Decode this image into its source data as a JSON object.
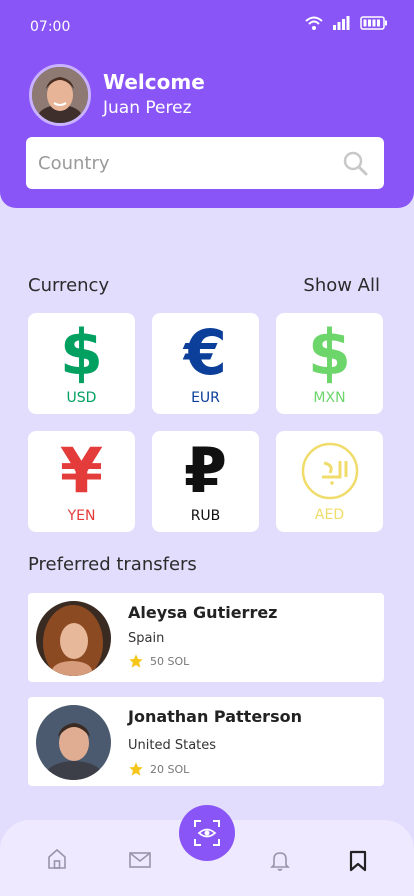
{
  "status_bar": {
    "time": "07:00"
  },
  "header": {
    "welcome": "Welcome",
    "username": "Juan Perez"
  },
  "search": {
    "placeholder": "Country",
    "value": ""
  },
  "currency": {
    "title": "Currency",
    "show_all": "Show All",
    "items": [
      {
        "glyph": "$",
        "code": "USD",
        "color": "#00a060"
      },
      {
        "glyph": "€",
        "code": "EUR",
        "color": "#0b3f9a"
      },
      {
        "glyph": "$",
        "code": "MXN",
        "color": "#6cd66b"
      },
      {
        "glyph": "¥",
        "code": "YEN",
        "color": "#e43b3b"
      },
      {
        "glyph": "₽",
        "code": "RUB",
        "color": "#111111"
      },
      {
        "glyph": "",
        "code": "AED",
        "color": "#f0dc6a"
      }
    ]
  },
  "transfers": {
    "title": "Preferred transfers",
    "items": [
      {
        "name": "Aleysa Gutierrez",
        "country": "Spain",
        "amount": "50 SOL"
      },
      {
        "name": "Jonathan Patterson",
        "country": "United States",
        "amount": "20 SOL"
      }
    ]
  },
  "colors": {
    "accent": "#8a55f6",
    "background": "#e2dcfd",
    "star": "#f5c518"
  },
  "icons": [
    "wifi-icon",
    "signal-icon",
    "battery-icon",
    "search-icon",
    "star-icon",
    "home-icon",
    "mail-icon",
    "scan-icon",
    "bell-icon",
    "bookmark-icon"
  ]
}
